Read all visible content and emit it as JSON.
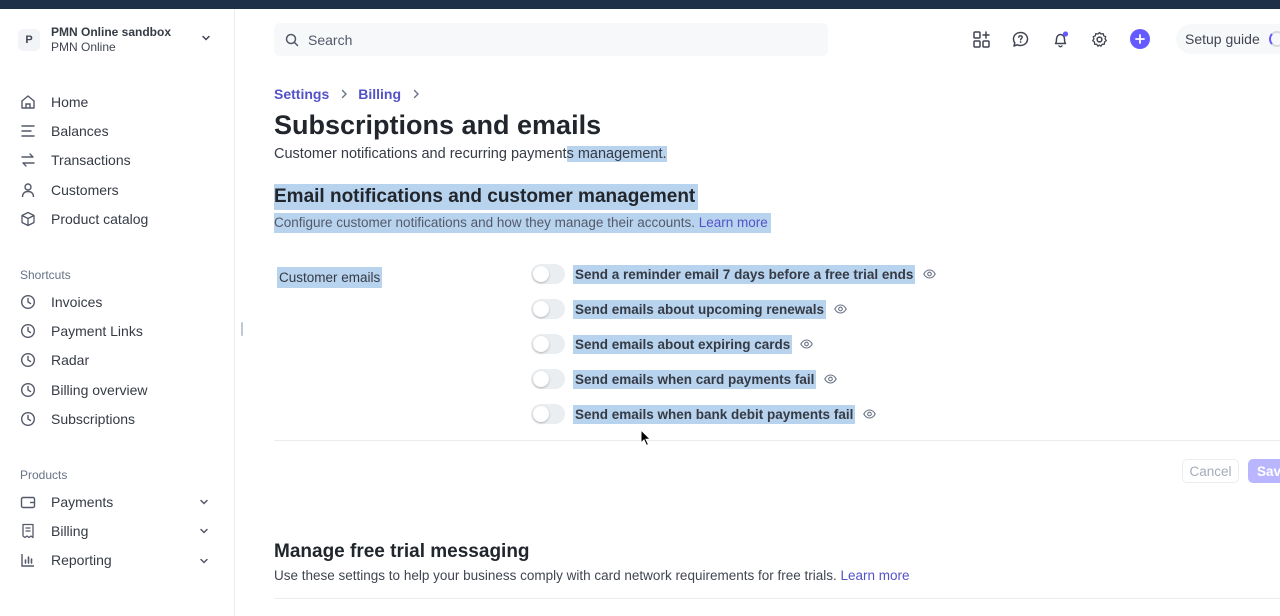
{
  "account": {
    "avatar_letter": "P",
    "name": "PMN Online sandbox",
    "sub": "PMN Online"
  },
  "sidebar": {
    "main_items": [
      {
        "label": "Home",
        "icon": "home-icon"
      },
      {
        "label": "Balances",
        "icon": "balances-icon"
      },
      {
        "label": "Transactions",
        "icon": "transactions-icon"
      },
      {
        "label": "Customers",
        "icon": "customers-icon"
      },
      {
        "label": "Product catalog",
        "icon": "product-catalog-icon"
      }
    ],
    "shortcuts_label": "Shortcuts",
    "shortcuts": [
      {
        "label": "Invoices",
        "icon": "clock-icon"
      },
      {
        "label": "Payment Links",
        "icon": "clock-icon"
      },
      {
        "label": "Radar",
        "icon": "clock-icon"
      },
      {
        "label": "Billing overview",
        "icon": "clock-icon"
      },
      {
        "label": "Subscriptions",
        "icon": "clock-icon"
      }
    ],
    "products_label": "Products",
    "products": [
      {
        "label": "Payments",
        "icon": "payments-icon"
      },
      {
        "label": "Billing",
        "icon": "billing-icon"
      },
      {
        "label": "Reporting",
        "icon": "reporting-icon"
      }
    ]
  },
  "header": {
    "search_placeholder": "Search",
    "setup_guide": "Setup guide"
  },
  "breadcrumb": [
    "Settings",
    "Billing"
  ],
  "page": {
    "title": "Subscriptions and emails",
    "subtitle_part1": "Customer notifications and recurring payment",
    "subtitle_part2": "s management."
  },
  "email_section": {
    "title": "Email notifications and customer management",
    "description": "Configure customer notifications and how they manage their accounts.",
    "learn_more": "Learn more",
    "group_label": "Customer emails",
    "toggles": [
      {
        "label": "Send a reminder email 7 days before a free trial ends",
        "enabled": false
      },
      {
        "label": "Send emails about upcoming renewals",
        "enabled": false
      },
      {
        "label": "Send emails about expiring cards",
        "enabled": false
      },
      {
        "label": "Send emails when card payments fail",
        "enabled": false
      },
      {
        "label": "Send emails when bank debit payments fail",
        "enabled": false
      }
    ],
    "cancel": "Cancel",
    "save": "Save"
  },
  "trial_section": {
    "title": "Manage free trial messaging",
    "description": "Use these settings to help your business comply with card network requirements for free trials.",
    "learn_more": "Learn more"
  },
  "colors": {
    "accent": "#635bff",
    "link": "#5452c7",
    "selection": "#b8d3ee"
  }
}
